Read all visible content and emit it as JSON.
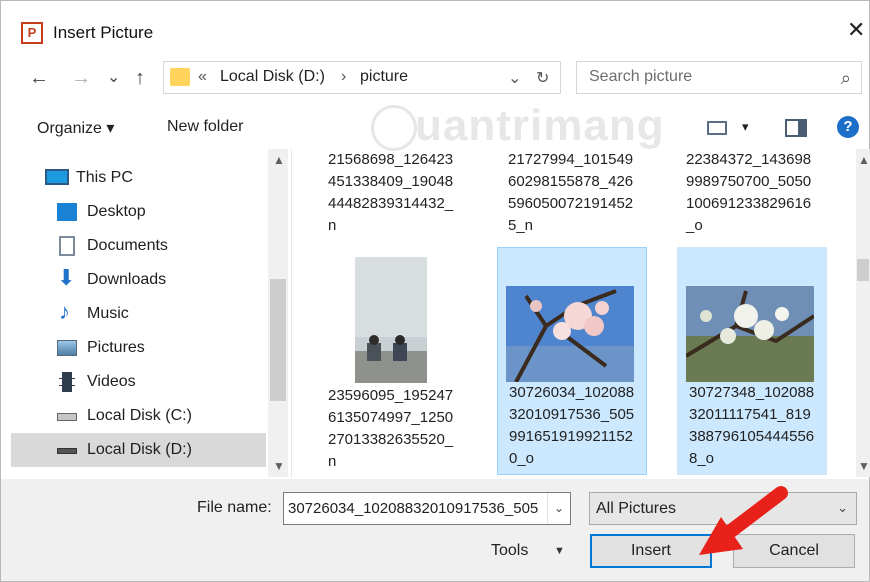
{
  "window": {
    "title": "Insert Picture",
    "app_icon_letter": "P",
    "close_glyph": "✕"
  },
  "nav": {
    "back": "←",
    "forward": "→",
    "recent": "⌄",
    "up": "↑",
    "breadcrumb_prefix": "«",
    "crumbs": [
      "Local Disk (D:)",
      "picture"
    ],
    "crumb_sep": "›",
    "dropdown": "⌄",
    "refresh": "↻",
    "search_placeholder": "Search picture"
  },
  "toolbar": {
    "organize": "Organize ▾",
    "new_folder": "New folder",
    "view_dropdown": "▾",
    "help": "?"
  },
  "watermark": "uantrimang",
  "sidebar": {
    "items": [
      {
        "label": "This PC",
        "icon": "pc-icon"
      },
      {
        "label": "Desktop",
        "icon": "desktop-icon"
      },
      {
        "label": "Documents",
        "icon": "documents-icon"
      },
      {
        "label": "Downloads",
        "icon": "downloads-icon"
      },
      {
        "label": "Music",
        "icon": "music-icon"
      },
      {
        "label": "Pictures",
        "icon": "pictures-icon"
      },
      {
        "label": "Videos",
        "icon": "videos-icon"
      },
      {
        "label": "Local Disk (C:)",
        "icon": "drive-icon"
      },
      {
        "label": "Local Disk (D:)",
        "icon": "drive-icon",
        "selected": true
      }
    ]
  },
  "files": [
    {
      "name": "21568698_126423451338409_1904844482839314432_n",
      "lines": [
        "21568698_126423",
        "451338409_19048",
        "44482839314432_",
        "n"
      ]
    },
    {
      "name": "21727994_10154960298155878_4265960500721914525_n",
      "lines": [
        "21727994_101549",
        "60298155878_426",
        "596050072191452",
        "5_n"
      ]
    },
    {
      "name": "22384372_1436989989750700_5050100691233829616_o",
      "lines": [
        "22384372_143698",
        "9989750700_5050",
        "100691233829616",
        "_o"
      ]
    },
    {
      "name": "23596095_1952476135074997_1250270133826355200_n",
      "lines": [
        "23596095_195247",
        "6135074997_1250",
        "27013382635520_",
        "n"
      ]
    },
    {
      "name": "30726034_10208832010917536_5059916519199211520_o",
      "lines": [
        "30726034_102088",
        "32010917536_505",
        "991651919921152",
        "0_o"
      ],
      "selected": true
    },
    {
      "name": "30727348_10208832011117541_8193887961054445568_o",
      "lines": [
        "30727348_102088",
        "32011117541_819",
        "388796105444556",
        "8_o"
      ],
      "selected": true
    }
  ],
  "bottom": {
    "file_name_label": "File name:",
    "file_name_value": "30726034_10208832010917536_505",
    "file_type": "All Pictures",
    "tools": "Tools",
    "tools_dd": "▼",
    "insert": "Insert",
    "cancel": "Cancel"
  },
  "colors": {
    "selection_bg": "#cce8ff",
    "accent": "#0078d7",
    "annotation_arrow": "#e8211a"
  }
}
